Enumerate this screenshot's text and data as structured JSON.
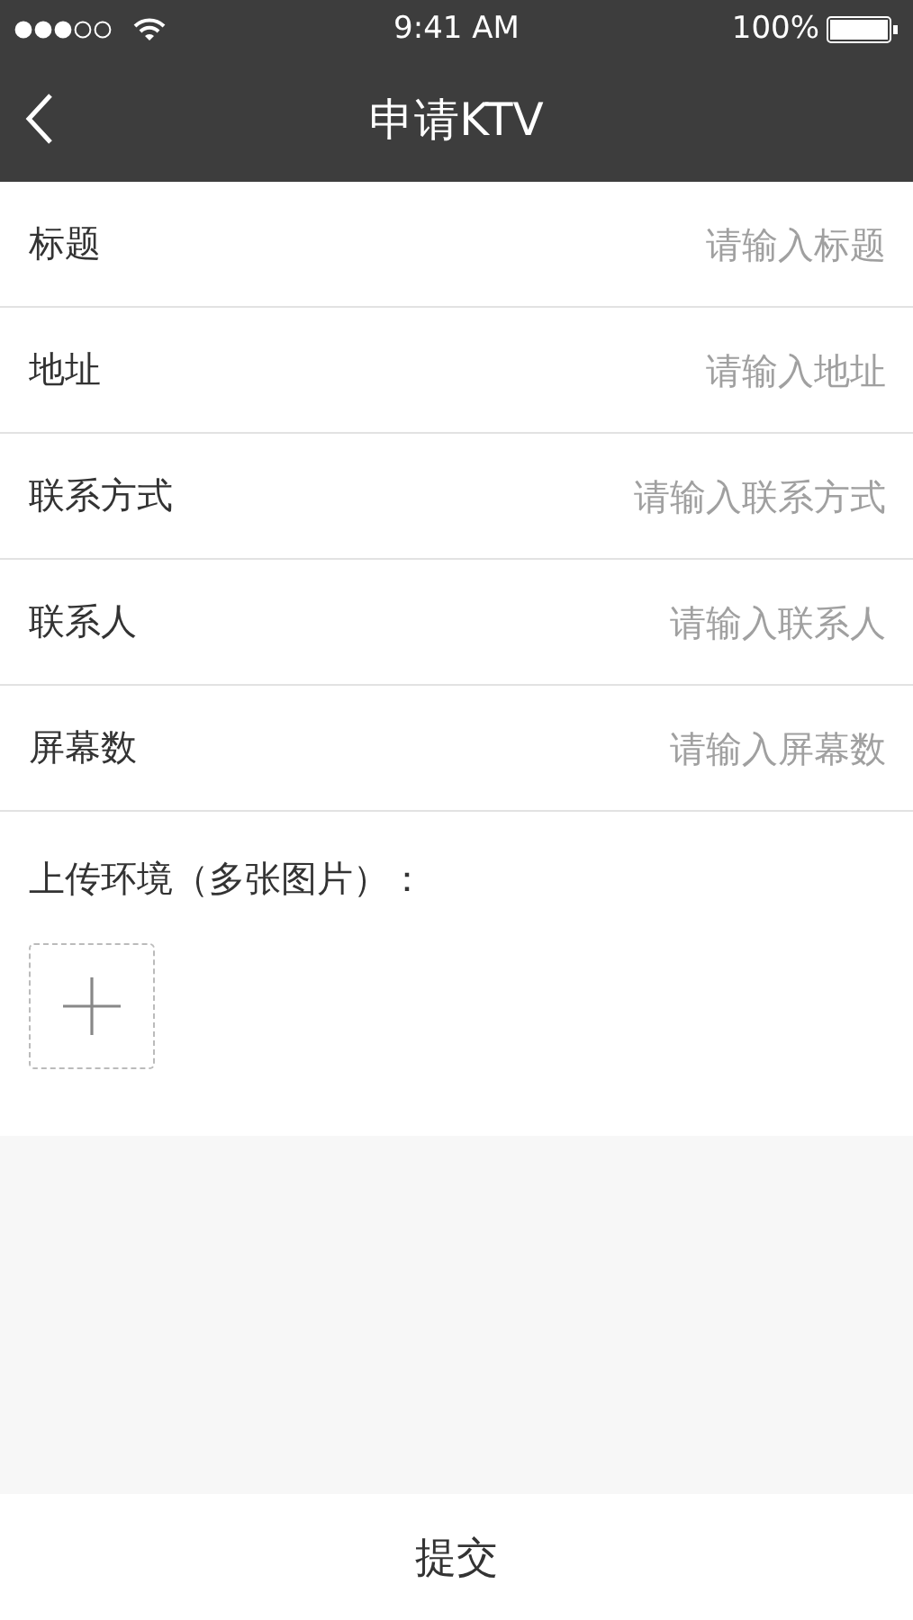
{
  "status_bar": {
    "time": "9:41 AM",
    "battery": "100%"
  },
  "nav": {
    "title": "申请KTV"
  },
  "fields": [
    {
      "label": "标题",
      "placeholder": "请输入标题"
    },
    {
      "label": "地址",
      "placeholder": "请输入地址"
    },
    {
      "label": "联系方式",
      "placeholder": "请输入联系方式"
    },
    {
      "label": "联系人",
      "placeholder": "请输入联系人"
    },
    {
      "label": "屏幕数",
      "placeholder": "请输入屏幕数"
    }
  ],
  "upload": {
    "label": "上传环境（多张图片）："
  },
  "submit": "提交"
}
